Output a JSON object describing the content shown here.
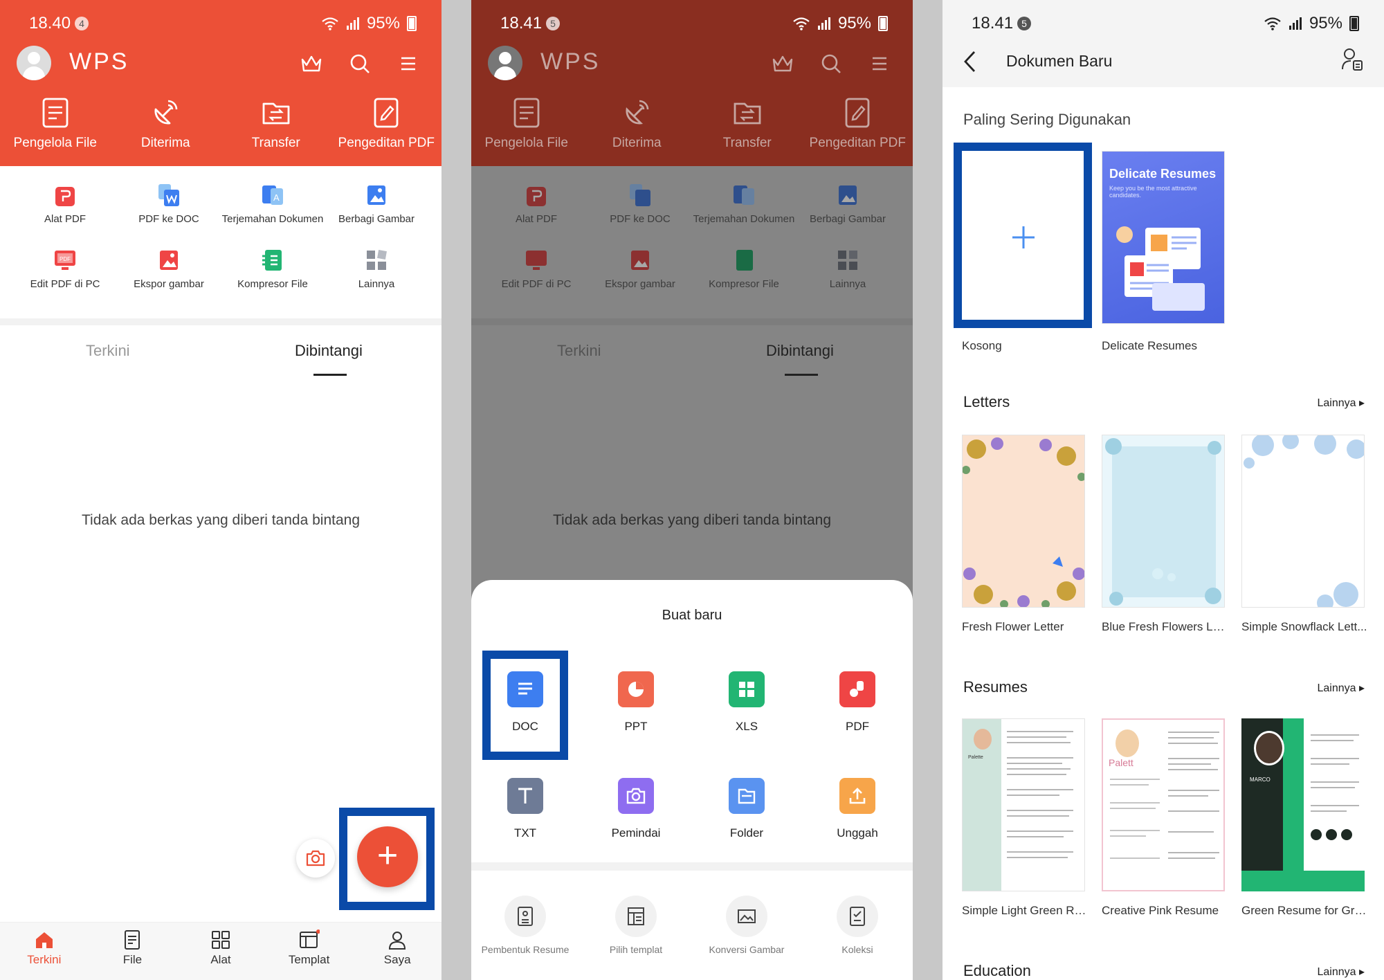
{
  "panel1": {
    "status": {
      "time": "18.40",
      "badge": "4",
      "battery": "95%"
    },
    "logo": "WPS",
    "header_items": [
      "Pengelola File",
      "Diterima",
      "Transfer",
      "Pengeditan PDF"
    ],
    "tools": [
      "Alat PDF",
      "PDF ke DOC",
      "Terjemahan Dokumen",
      "Berbagi Gambar",
      "Edit PDF di PC",
      "Ekspor gambar",
      "Kompresor File",
      "Lainnya"
    ],
    "tabs": [
      "Terkini",
      "Dibintangi"
    ],
    "empty_text": "Tidak ada berkas yang diberi tanda bintang",
    "fab": "+",
    "bottom_nav": [
      "Terkini",
      "File",
      "Alat",
      "Templat",
      "Saya"
    ]
  },
  "panel2": {
    "status": {
      "time": "18.41",
      "badge": "5",
      "battery": "95%"
    },
    "sheet_title": "Buat baru",
    "create_row1": [
      "DOC",
      "PPT",
      "XLS",
      "PDF"
    ],
    "create_row2": [
      "TXT",
      "Pemindai",
      "Folder",
      "Unggah"
    ],
    "tools_row": [
      "Pembentuk Resume",
      "Pilih templat",
      "Konversi Gambar",
      "Koleksi"
    ]
  },
  "panel3": {
    "status": {
      "time": "18.41",
      "badge": "5",
      "battery": "95%"
    },
    "title": "Dokumen Baru",
    "most_used": "Paling Sering Digunakan",
    "most_used_items": [
      "Kosong",
      "Delicate Resumes"
    ],
    "delicate_title": "Delicate Resumes",
    "delicate_sub": "Keep you be the most attractive candidates.",
    "letters": "Letters",
    "letters_items": [
      "Fresh Flower Letter",
      "Blue Fresh Flowers Let...",
      "Simple Snowflack Lett..."
    ],
    "resumes": "Resumes",
    "resumes_items": [
      "Simple Light Green Re...",
      "Creative Pink Resume",
      "Green Resume for Gra..."
    ],
    "resume_names": [
      "Palette",
      "Palett",
      "MARCO"
    ],
    "education": "Education",
    "more": "Lainnya"
  },
  "colors": {
    "accent": "#ec5037",
    "highlight": "#0a4aa8",
    "doc": "#3d7ef0",
    "ppt": "#f0674e",
    "xls": "#22b573",
    "pdf": "#ef4545"
  }
}
